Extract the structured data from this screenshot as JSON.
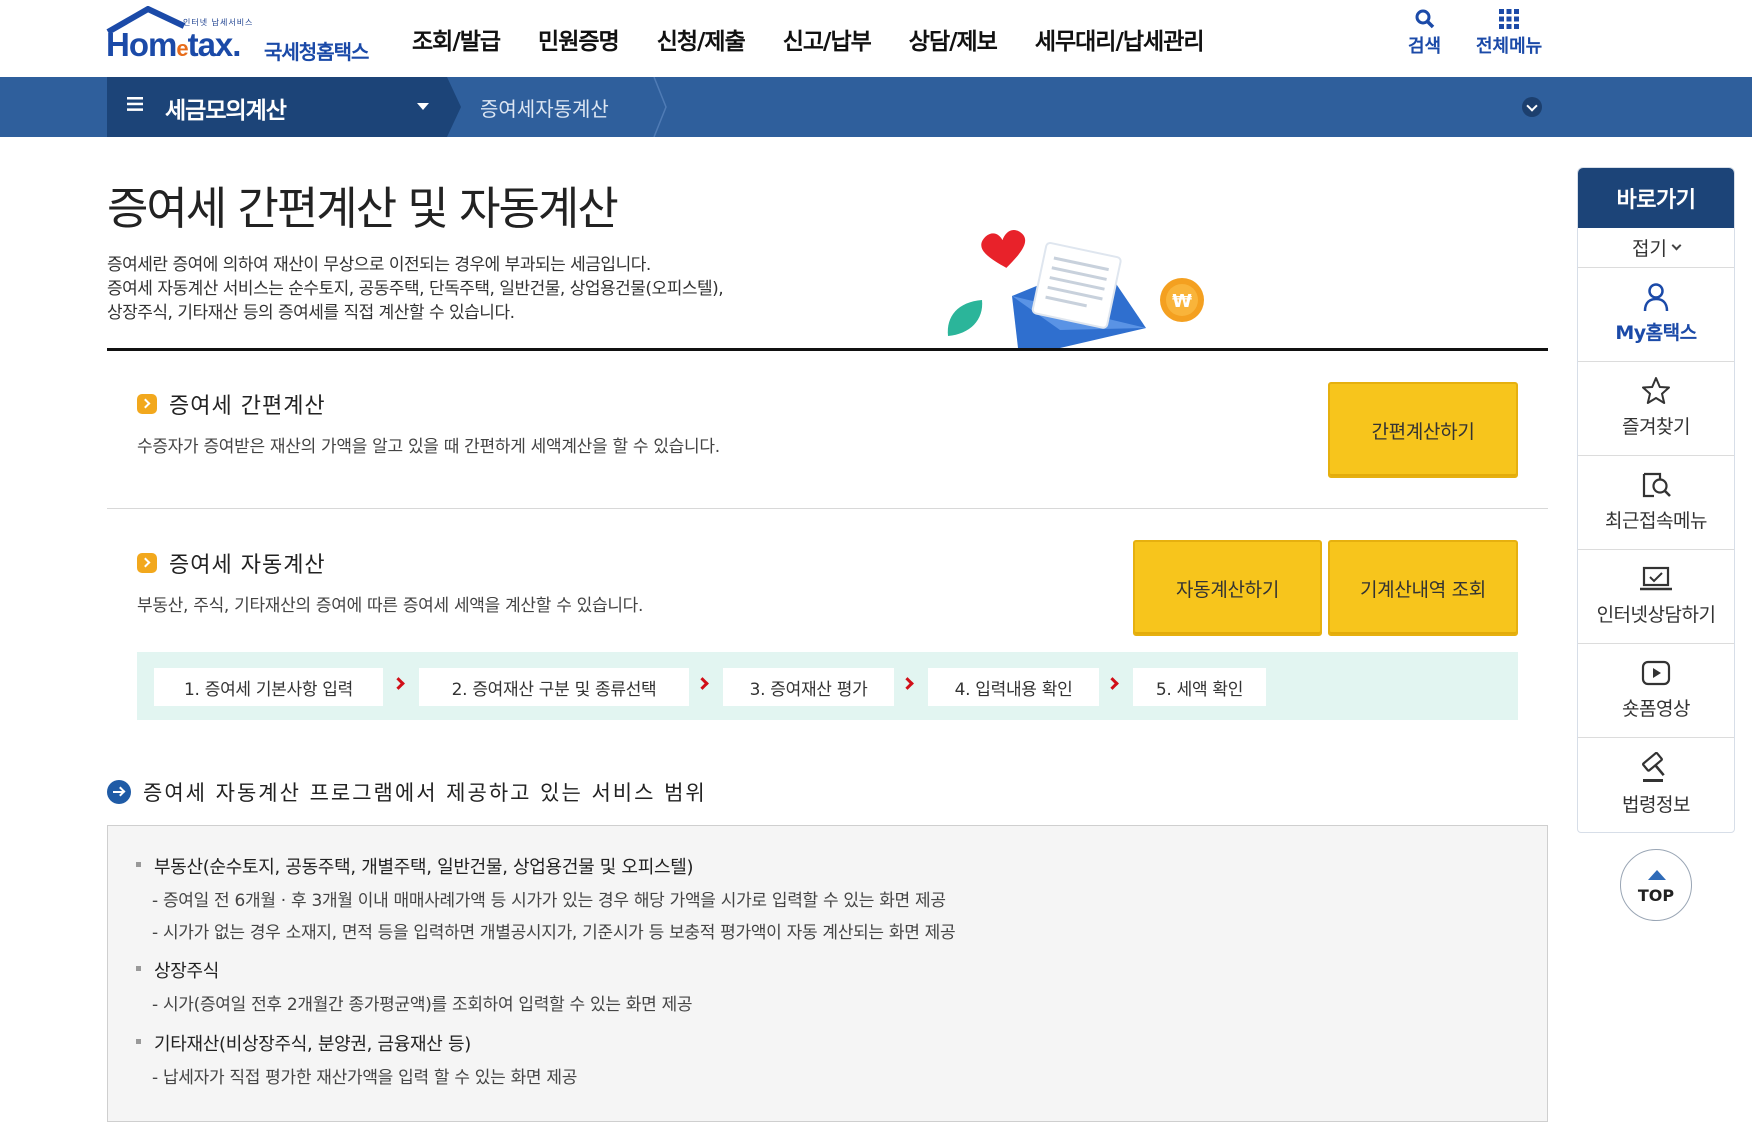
{
  "header": {
    "logo_small": "인터넷 납세서비스",
    "logo_brand_a": "Hom",
    "logo_brand_e": "e",
    "logo_brand_b": "tax.",
    "logo_kor": "국세청홈택스",
    "gnb": [
      "조회/발급",
      "민원증명",
      "신청/제출",
      "신고/납부",
      "상담/제보",
      "세무대리/납세관리"
    ],
    "search_label": "검색",
    "allmenu_label": "전체메뉴"
  },
  "navbar": {
    "menu_label": "세금모의계산",
    "sub_label": "증여세자동계산"
  },
  "page": {
    "title": "증여세 간편계산 및 자동계산",
    "intro": [
      "증여세란 증여에 의하여 재산이 무상으로 이전되는 경우에 부과되는 세금입니다.",
      "증여세 자동계산 서비스는 순수토지, 공동주택, 단독주택, 일반건물, 상업용건물(오피스텔),",
      "상장주식, 기타재산 등의 증여세를 직접 계산할 수 있습니다."
    ]
  },
  "simple": {
    "title": "증여세 간편계산",
    "desc": "수증자가 증여받은 재산의 가액을 알고 있을 때 간편하게 세액계산을 할 수 있습니다.",
    "button": "간편계산하기"
  },
  "auto": {
    "title": "증여세 자동계산",
    "desc": "부동산, 주식, 기타재산의 증여에 따른 증여세 세액을 계산할 수 있습니다.",
    "button": "자동계산하기",
    "history_button": "기계산내역 조회",
    "steps": [
      "1. 증여세 기본사항 입력",
      "2. 증여재산 구분 및 종류선택",
      "3. 증여재산 평가",
      "4. 입력내용 확인",
      "5. 세액 확인"
    ]
  },
  "scope": {
    "title": "증여세 자동계산 프로그램에서 제공하고 있는 서비스 범위",
    "items": [
      {
        "label": "부동산(순수토지, 공동주택, 개별주택, 일반건물, 상업용건물 및 오피스텔)",
        "subs": [
          "- 증여일 전 6개월 · 후 3개월 이내 매매사례가액 등 시가가 있는 경우 해당 가액을 시가로 입력할 수 있는 화면 제공",
          "- 시가가 없는 경우 소재지, 면적 등을 입력하면 개별공시지가, 기준시가 등 보충적 평가액이 자동 계산되는 화면 제공"
        ]
      },
      {
        "label": "상장주식",
        "subs": [
          "- 시가(증여일 전후 2개월간 종가평균액)를 조회하여 입력할 수 있는 화면 제공"
        ]
      },
      {
        "label": "기타재산(비상장주식, 분양권, 금융재산 등)",
        "subs": [
          "- 납세자가 직접 평가한 재산가액을 입력 할 수 있는 화면 제공"
        ]
      }
    ]
  },
  "quick": {
    "title": "바로가기",
    "fold": "접기",
    "items": [
      {
        "label": "My홈택스",
        "icon": "person-icon"
      },
      {
        "label": "즐겨찾기",
        "icon": "star-icon"
      },
      {
        "label": "최근접속메뉴",
        "icon": "recent-search-icon"
      },
      {
        "label": "인터넷상담하기",
        "icon": "laptop-chat-icon"
      },
      {
        "label": "숏폼영상",
        "icon": "play-video-icon"
      },
      {
        "label": "법령정보",
        "icon": "gavel-icon"
      }
    ],
    "top": "TOP"
  },
  "colors": {
    "primary_blue": "#1c4478",
    "bar_blue": "#2f5f9c",
    "button_yellow": "#f7c51c",
    "steps_bg": "#e2f5f1",
    "arrow_red": "#d10f18"
  }
}
